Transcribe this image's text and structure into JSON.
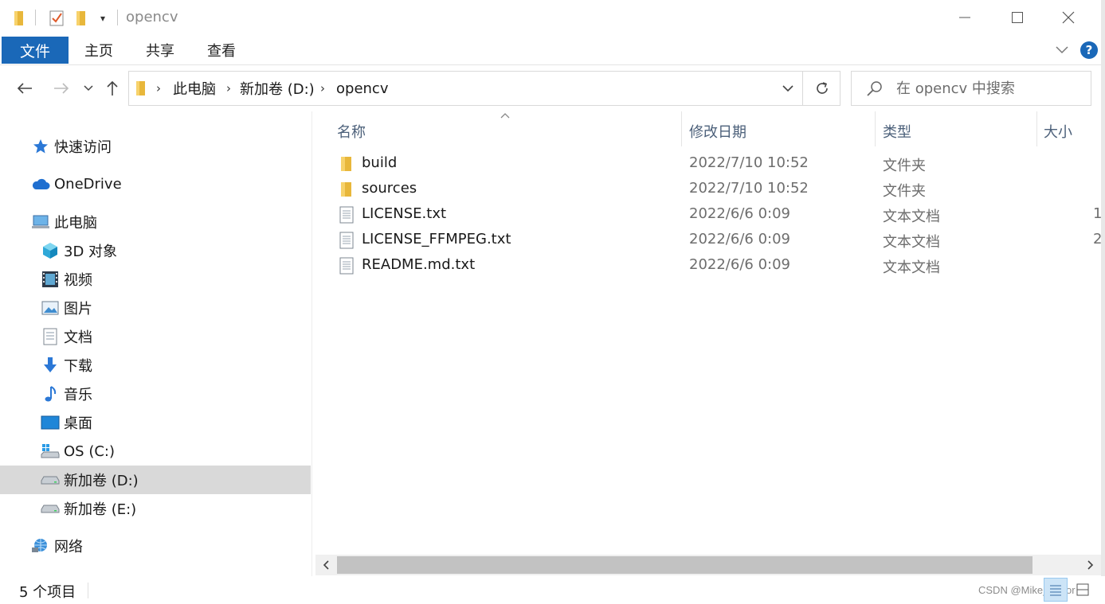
{
  "window": {
    "title": "opencv",
    "accent": "#1a68b8"
  },
  "ribbon": {
    "tabs": [
      {
        "label": "文件",
        "active": true
      },
      {
        "label": "主页"
      },
      {
        "label": "共享"
      },
      {
        "label": "查看"
      }
    ],
    "help": "?"
  },
  "navigation": {
    "back_icon": "arrow-left-icon",
    "forward_icon": "arrow-right-icon",
    "recent_icon": "chevron-down-icon",
    "up_icon": "arrow-up-icon"
  },
  "address": {
    "crumbs": [
      "此电脑",
      "新加卷 (D:)",
      "opencv"
    ]
  },
  "search": {
    "placeholder": "在 opencv 中搜索"
  },
  "sidebar": {
    "items": [
      {
        "label": "快速访问",
        "icon": "star-icon"
      },
      {
        "label": "OneDrive",
        "icon": "cloud-icon"
      },
      {
        "label": "此电脑",
        "icon": "computer-icon"
      },
      {
        "label": "3D 对象",
        "icon": "cube-icon"
      },
      {
        "label": "视频",
        "icon": "film-icon"
      },
      {
        "label": "图片",
        "icon": "picture-icon"
      },
      {
        "label": "文档",
        "icon": "document-icon"
      },
      {
        "label": "下载",
        "icon": "download-icon"
      },
      {
        "label": "音乐",
        "icon": "music-icon"
      },
      {
        "label": "桌面",
        "icon": "desktop-icon"
      },
      {
        "label": "OS (C:)",
        "icon": "windows-drive-icon"
      },
      {
        "label": "新加卷 (D:)",
        "icon": "drive-icon",
        "selected": true
      },
      {
        "label": "新加卷 (E:)",
        "icon": "drive-icon"
      },
      {
        "label": "网络",
        "icon": "network-icon"
      }
    ]
  },
  "filelist": {
    "columns": [
      "名称",
      "修改日期",
      "类型",
      "大小"
    ],
    "rows": [
      {
        "name": "build",
        "date": "2022/7/10 10:52",
        "type": "文件夹",
        "size": "",
        "icon": "folder-icon"
      },
      {
        "name": "sources",
        "date": "2022/7/10 10:52",
        "type": "文件夹",
        "size": "",
        "icon": "folder-icon"
      },
      {
        "name": "LICENSE.txt",
        "date": "2022/6/6 0:09",
        "type": "文本文档",
        "size": "1",
        "icon": "text-file-icon"
      },
      {
        "name": "LICENSE_FFMPEG.txt",
        "date": "2022/6/6 0:09",
        "type": "文本文档",
        "size": "2",
        "icon": "text-file-icon"
      },
      {
        "name": "README.md.txt",
        "date": "2022/6/6 0:09",
        "type": "文本文档",
        "size": "",
        "icon": "text-file-icon"
      }
    ]
  },
  "status": {
    "count": "5 个项目",
    "watermark": "CSDN @Mike_honor"
  }
}
